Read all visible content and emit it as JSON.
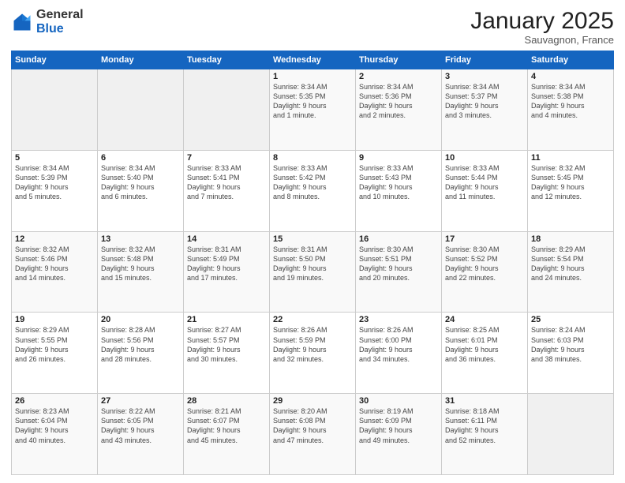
{
  "header": {
    "logo_general": "General",
    "logo_blue": "Blue",
    "month": "January 2025",
    "location": "Sauvagnon, France"
  },
  "days_of_week": [
    "Sunday",
    "Monday",
    "Tuesday",
    "Wednesday",
    "Thursday",
    "Friday",
    "Saturday"
  ],
  "weeks": [
    [
      {
        "num": "",
        "info": ""
      },
      {
        "num": "",
        "info": ""
      },
      {
        "num": "",
        "info": ""
      },
      {
        "num": "1",
        "info": "Sunrise: 8:34 AM\nSunset: 5:35 PM\nDaylight: 9 hours\nand 1 minute."
      },
      {
        "num": "2",
        "info": "Sunrise: 8:34 AM\nSunset: 5:36 PM\nDaylight: 9 hours\nand 2 minutes."
      },
      {
        "num": "3",
        "info": "Sunrise: 8:34 AM\nSunset: 5:37 PM\nDaylight: 9 hours\nand 3 minutes."
      },
      {
        "num": "4",
        "info": "Sunrise: 8:34 AM\nSunset: 5:38 PM\nDaylight: 9 hours\nand 4 minutes."
      }
    ],
    [
      {
        "num": "5",
        "info": "Sunrise: 8:34 AM\nSunset: 5:39 PM\nDaylight: 9 hours\nand 5 minutes."
      },
      {
        "num": "6",
        "info": "Sunrise: 8:34 AM\nSunset: 5:40 PM\nDaylight: 9 hours\nand 6 minutes."
      },
      {
        "num": "7",
        "info": "Sunrise: 8:33 AM\nSunset: 5:41 PM\nDaylight: 9 hours\nand 7 minutes."
      },
      {
        "num": "8",
        "info": "Sunrise: 8:33 AM\nSunset: 5:42 PM\nDaylight: 9 hours\nand 8 minutes."
      },
      {
        "num": "9",
        "info": "Sunrise: 8:33 AM\nSunset: 5:43 PM\nDaylight: 9 hours\nand 10 minutes."
      },
      {
        "num": "10",
        "info": "Sunrise: 8:33 AM\nSunset: 5:44 PM\nDaylight: 9 hours\nand 11 minutes."
      },
      {
        "num": "11",
        "info": "Sunrise: 8:32 AM\nSunset: 5:45 PM\nDaylight: 9 hours\nand 12 minutes."
      }
    ],
    [
      {
        "num": "12",
        "info": "Sunrise: 8:32 AM\nSunset: 5:46 PM\nDaylight: 9 hours\nand 14 minutes."
      },
      {
        "num": "13",
        "info": "Sunrise: 8:32 AM\nSunset: 5:48 PM\nDaylight: 9 hours\nand 15 minutes."
      },
      {
        "num": "14",
        "info": "Sunrise: 8:31 AM\nSunset: 5:49 PM\nDaylight: 9 hours\nand 17 minutes."
      },
      {
        "num": "15",
        "info": "Sunrise: 8:31 AM\nSunset: 5:50 PM\nDaylight: 9 hours\nand 19 minutes."
      },
      {
        "num": "16",
        "info": "Sunrise: 8:30 AM\nSunset: 5:51 PM\nDaylight: 9 hours\nand 20 minutes."
      },
      {
        "num": "17",
        "info": "Sunrise: 8:30 AM\nSunset: 5:52 PM\nDaylight: 9 hours\nand 22 minutes."
      },
      {
        "num": "18",
        "info": "Sunrise: 8:29 AM\nSunset: 5:54 PM\nDaylight: 9 hours\nand 24 minutes."
      }
    ],
    [
      {
        "num": "19",
        "info": "Sunrise: 8:29 AM\nSunset: 5:55 PM\nDaylight: 9 hours\nand 26 minutes."
      },
      {
        "num": "20",
        "info": "Sunrise: 8:28 AM\nSunset: 5:56 PM\nDaylight: 9 hours\nand 28 minutes."
      },
      {
        "num": "21",
        "info": "Sunrise: 8:27 AM\nSunset: 5:57 PM\nDaylight: 9 hours\nand 30 minutes."
      },
      {
        "num": "22",
        "info": "Sunrise: 8:26 AM\nSunset: 5:59 PM\nDaylight: 9 hours\nand 32 minutes."
      },
      {
        "num": "23",
        "info": "Sunrise: 8:26 AM\nSunset: 6:00 PM\nDaylight: 9 hours\nand 34 minutes."
      },
      {
        "num": "24",
        "info": "Sunrise: 8:25 AM\nSunset: 6:01 PM\nDaylight: 9 hours\nand 36 minutes."
      },
      {
        "num": "25",
        "info": "Sunrise: 8:24 AM\nSunset: 6:03 PM\nDaylight: 9 hours\nand 38 minutes."
      }
    ],
    [
      {
        "num": "26",
        "info": "Sunrise: 8:23 AM\nSunset: 6:04 PM\nDaylight: 9 hours\nand 40 minutes."
      },
      {
        "num": "27",
        "info": "Sunrise: 8:22 AM\nSunset: 6:05 PM\nDaylight: 9 hours\nand 43 minutes."
      },
      {
        "num": "28",
        "info": "Sunrise: 8:21 AM\nSunset: 6:07 PM\nDaylight: 9 hours\nand 45 minutes."
      },
      {
        "num": "29",
        "info": "Sunrise: 8:20 AM\nSunset: 6:08 PM\nDaylight: 9 hours\nand 47 minutes."
      },
      {
        "num": "30",
        "info": "Sunrise: 8:19 AM\nSunset: 6:09 PM\nDaylight: 9 hours\nand 49 minutes."
      },
      {
        "num": "31",
        "info": "Sunrise: 8:18 AM\nSunset: 6:11 PM\nDaylight: 9 hours\nand 52 minutes."
      },
      {
        "num": "",
        "info": ""
      }
    ]
  ]
}
